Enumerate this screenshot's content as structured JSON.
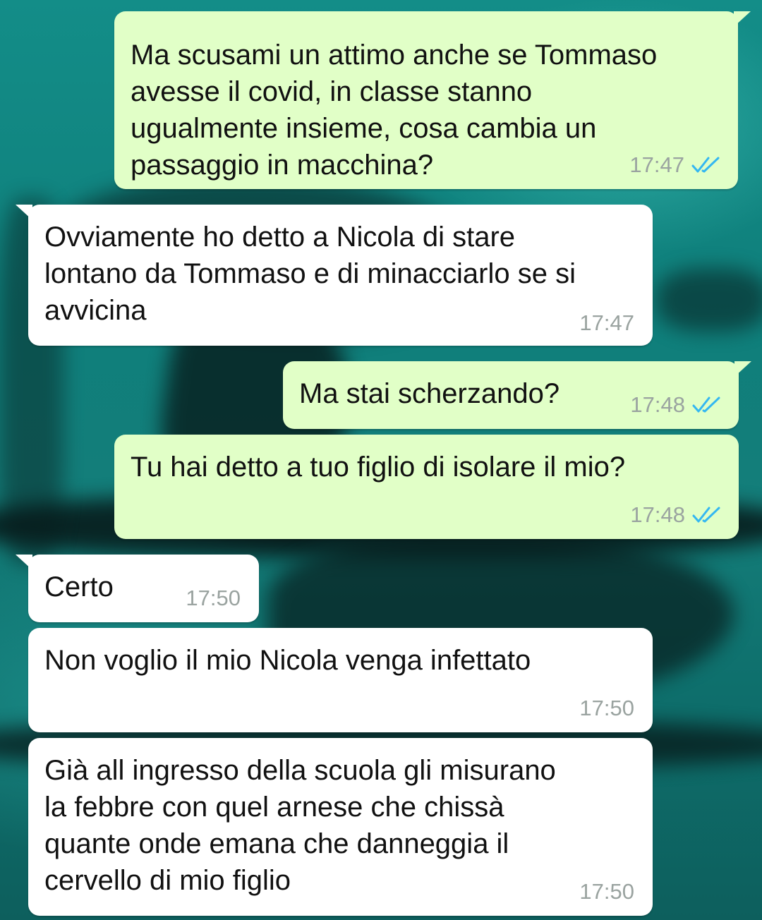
{
  "colors": {
    "outgoing_bubble": "#e1ffc7",
    "incoming_bubble": "#ffffff",
    "timestamp": "#9aa3a0",
    "read_ticks": "#34b7f1",
    "wallpaper": "#0f8a86"
  },
  "messages": [
    {
      "direction": "outgoing",
      "lines": [
        "Ma scusami un attimo anche se Tommaso",
        "avesse il covid, in classe stanno",
        "ugualmente insieme, cosa cambia un",
        "passaggio in macchina?"
      ],
      "time": "17:47",
      "status_icon": "double-check-read-icon"
    },
    {
      "direction": "incoming",
      "lines": [
        "Ovviamente ho detto a Nicola di stare",
        "lontano da Tommaso e di minacciarlo se si",
        "avvicina"
      ],
      "time": "17:47"
    },
    {
      "direction": "outgoing",
      "lines": [
        "Ma stai scherzando?"
      ],
      "time": "17:48",
      "status_icon": "double-check-read-icon"
    },
    {
      "direction": "outgoing",
      "lines": [
        "Tu hai detto a tuo figlio di isolare il mio?"
      ],
      "time": "17:48",
      "status_icon": "double-check-read-icon"
    },
    {
      "direction": "incoming",
      "lines": [
        "Certo"
      ],
      "time": "17:50"
    },
    {
      "direction": "incoming",
      "lines": [
        "Non voglio il mio Nicola venga infettato"
      ],
      "time": "17:50"
    },
    {
      "direction": "incoming",
      "lines": [
        "Già all ingresso della scuola gli misurano",
        "la febbre con quel arnese che chissà",
        "quante onde emana che danneggia il",
        "cervello di mio figlio"
      ],
      "time": "17:50"
    }
  ]
}
